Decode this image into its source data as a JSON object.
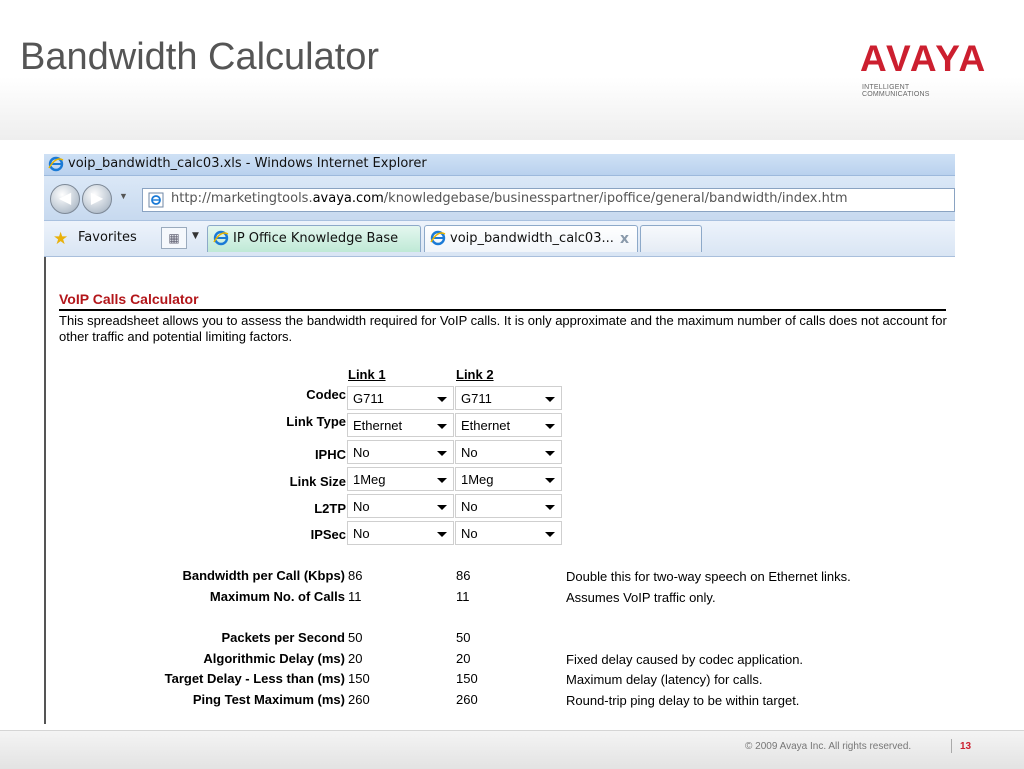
{
  "slide": {
    "title": "Bandwidth Calculator",
    "logo_text": "AVAYA",
    "logo_tagline": "INTELLIGENT COMMUNICATIONS",
    "copyright": "© 2009 Avaya Inc. All rights reserved.",
    "page_number": "13",
    "brand_color": "#cc1f2f"
  },
  "browser": {
    "window_title": "voip_bandwidth_calc03.xls - Windows Internet Explorer",
    "url_prefix": "http://marketingtools.",
    "url_domain": "avaya.com",
    "url_path": "/knowledgebase/businesspartner/ipoffice/general/bandwidth/index.htm",
    "favorites_label": "Favorites",
    "tabs": [
      {
        "label": "IP Office Knowledge Base",
        "active": false
      },
      {
        "label": "voip_bandwidth_calc03...",
        "active": true
      }
    ],
    "tab_close": "x"
  },
  "calculator": {
    "title": "VoIP Calls Calculator",
    "title_color": "#b3161a",
    "description": "This spreadsheet allows you to assess the bandwidth required for VoIP calls. It is only approximate and the maximum number of calls does not account for other traffic and potential limiting factors.",
    "columns": [
      "Link 1",
      "Link 2"
    ],
    "settings": [
      {
        "label": "Codec",
        "link1": "G711",
        "link2": "G711"
      },
      {
        "label": "Link Type",
        "link1": "Ethernet",
        "link2": "Ethernet"
      },
      {
        "label": "IPHC",
        "link1": "No",
        "link2": "No"
      },
      {
        "label": "Link Size",
        "link1": "1Meg",
        "link2": "1Meg"
      },
      {
        "label": "L2TP",
        "link1": "No",
        "link2": "No"
      },
      {
        "label": "IPSec",
        "link1": "No",
        "link2": "No"
      }
    ],
    "results_group1": [
      {
        "label": "Bandwidth per Call (Kbps)",
        "link1": "86",
        "link2": "86",
        "note": "Double this for two-way speech on Ethernet links."
      },
      {
        "label": "Maximum No. of Calls",
        "link1": "11",
        "link2": "11",
        "note": "Assumes VoIP traffic only."
      }
    ],
    "results_group2": [
      {
        "label": "Packets per Second",
        "link1": "50",
        "link2": "50",
        "note": ""
      },
      {
        "label": "Algorithmic Delay (ms)",
        "link1": "20",
        "link2": "20",
        "note": "Fixed delay caused by codec application."
      },
      {
        "label": "Target Delay - Less than (ms)",
        "link1": "150",
        "link2": "150",
        "note": "Maximum delay (latency) for calls."
      },
      {
        "label": "Ping Test Maximum (ms)",
        "link1": "260",
        "link2": "260",
        "note": "Round-trip ping delay to be within target."
      }
    ]
  }
}
